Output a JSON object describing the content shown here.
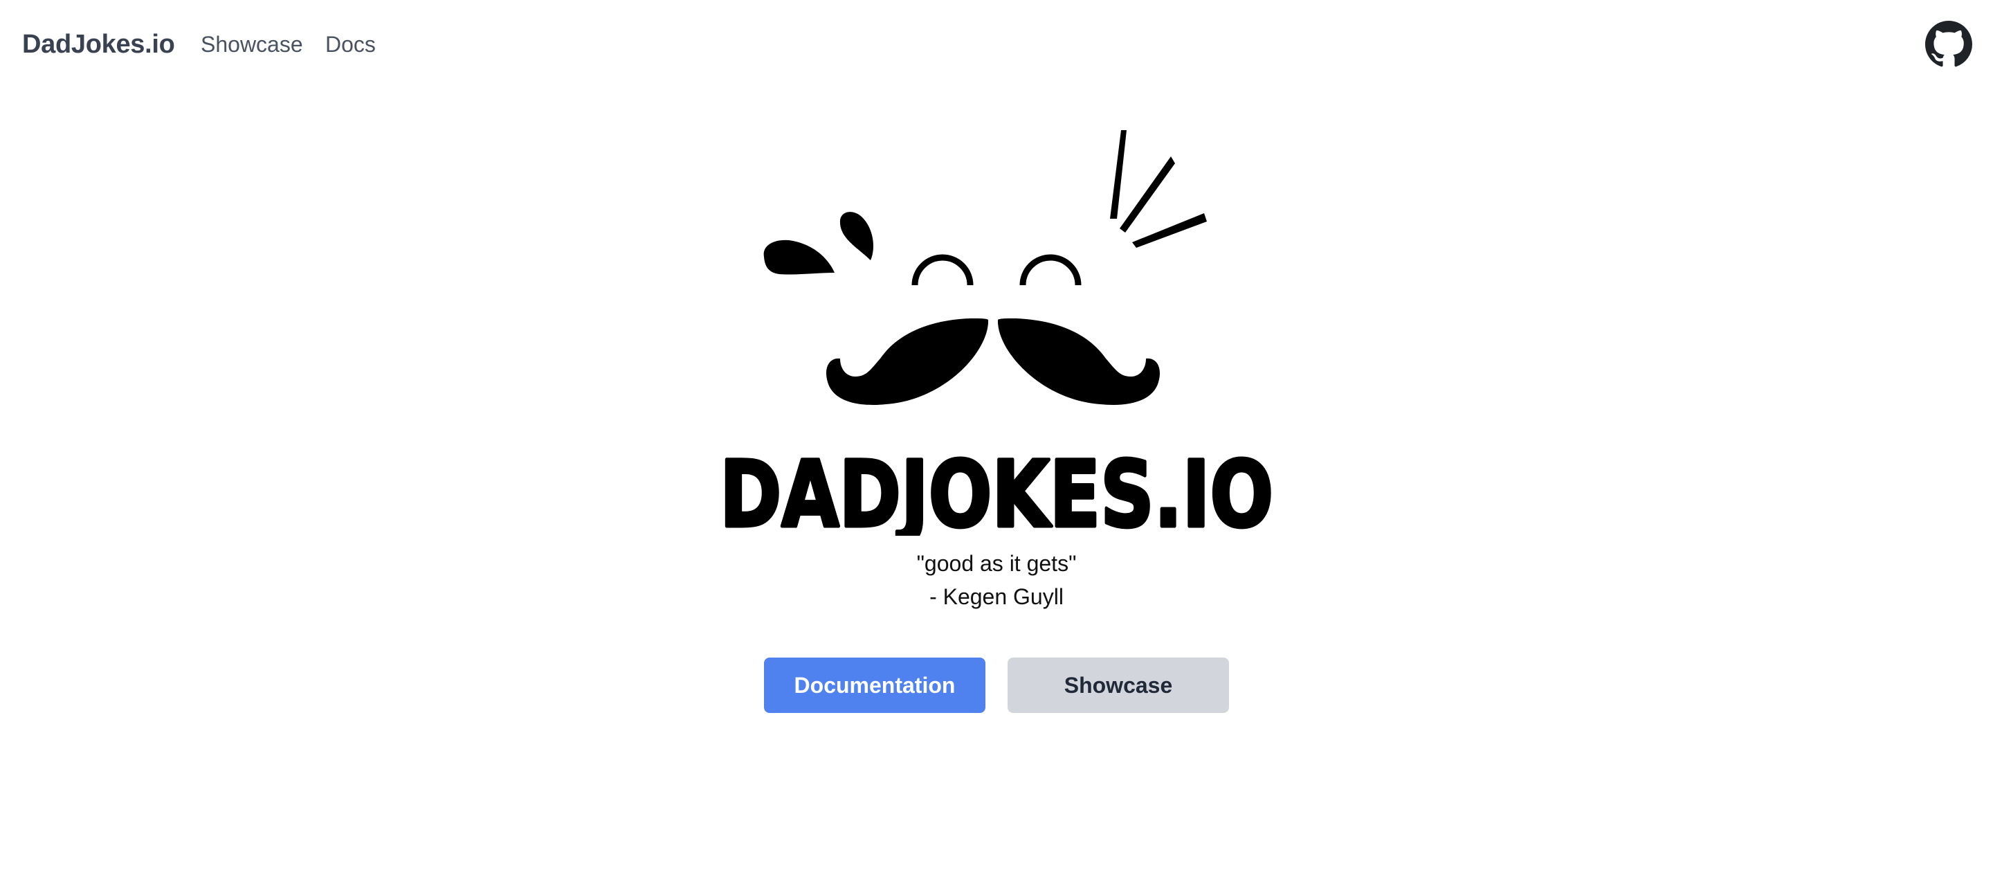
{
  "nav": {
    "brand": "DadJokes.io",
    "links": [
      "Showcase",
      "Docs"
    ],
    "github_icon": "github-icon"
  },
  "hero": {
    "wordmark": "DADJOKES.IO",
    "quote_line1": "\"good as it gets\"",
    "quote_line2": "- Kegen Guyll"
  },
  "buttons": {
    "primary": "Documentation",
    "secondary": "Showcase"
  },
  "colors": {
    "primary_button": "#4f82ee",
    "secondary_button": "#d2d5db",
    "nav_text": "#3a4252"
  }
}
